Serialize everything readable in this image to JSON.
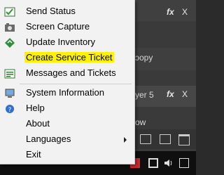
{
  "menu": {
    "items": [
      {
        "label": "Send Status",
        "icon": "send-status-icon"
      },
      {
        "label": "Screen Capture",
        "icon": "camera-icon"
      },
      {
        "label": "Update Inventory",
        "icon": "update-inventory-icon"
      },
      {
        "label": "Create Service Ticket",
        "icon": "",
        "highlighted": true
      },
      {
        "label": "Messages and Tickets",
        "icon": "messages-icon"
      },
      {
        "label": "System Information",
        "icon": "computer-icon"
      },
      {
        "label": "Help",
        "icon": "help-icon"
      },
      {
        "label": "About",
        "icon": ""
      },
      {
        "label": "Languages",
        "icon": "",
        "submenu": true
      },
      {
        "label": "Exit",
        "icon": ""
      }
    ]
  },
  "background": {
    "row1_text": "ɔopy",
    "row2_text": "yer 5",
    "row3_text": "ow",
    "fx_label": "fx",
    "close_label": "X"
  },
  "colors": {
    "highlight": "#fff200",
    "menu_bg": "#f2f2f2",
    "bg_dark": "#3a3a3a"
  }
}
